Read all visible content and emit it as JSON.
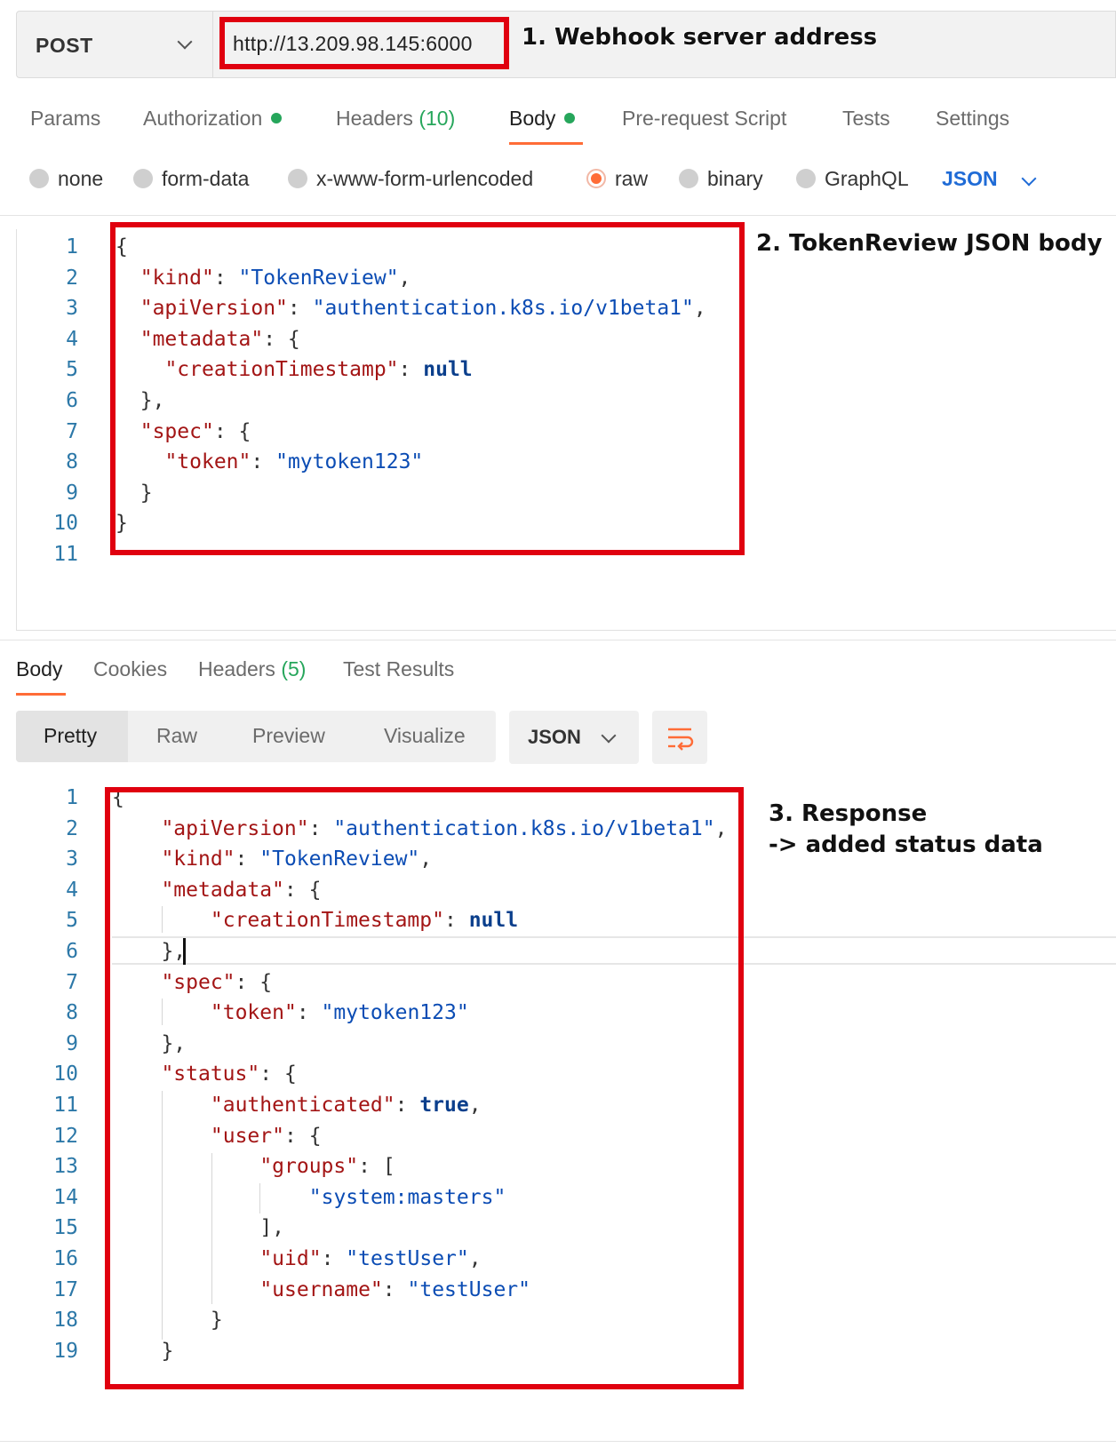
{
  "request": {
    "method": "POST",
    "url": "http://13.209.98.145:6000",
    "tabs": [
      {
        "label": "Params"
      },
      {
        "label": "Authorization"
      },
      {
        "label": "Headers",
        "count": "(10)"
      },
      {
        "label": "Body"
      },
      {
        "label": "Pre-request Script"
      },
      {
        "label": "Tests"
      },
      {
        "label": "Settings"
      }
    ],
    "body_types": [
      "none",
      "form-data",
      "x-www-form-urlencoded",
      "raw",
      "binary",
      "GraphQL"
    ],
    "selected_body_type": "raw",
    "language": "JSON",
    "line_numbers": [
      "1",
      "2",
      "3",
      "4",
      "5",
      "6",
      "7",
      "8",
      "9",
      "10",
      "11"
    ],
    "code_lines": [
      "{",
      "  \"kind\": \"TokenReview\",",
      "  \"apiVersion\": \"authentication.k8s.io/v1beta1\",",
      "  \"metadata\": {",
      "    \"creationTimestamp\": null",
      "  },",
      "  \"spec\": {",
      "    \"token\": \"mytoken123\"",
      "  }",
      "}",
      ""
    ]
  },
  "response": {
    "tabs": [
      {
        "label": "Body"
      },
      {
        "label": "Cookies"
      },
      {
        "label": "Headers",
        "count": "(5)"
      },
      {
        "label": "Test Results"
      }
    ],
    "views": [
      "Pretty",
      "Raw",
      "Preview",
      "Visualize"
    ],
    "format": "JSON",
    "line_numbers": [
      "1",
      "2",
      "3",
      "4",
      "5",
      "6",
      "7",
      "8",
      "9",
      "10",
      "11",
      "12",
      "13",
      "14",
      "15",
      "16",
      "17",
      "18",
      "19"
    ],
    "code_lines": [
      "{",
      "    \"apiVersion\": \"authentication.k8s.io/v1beta1\",",
      "    \"kind\": \"TokenReview\",",
      "    \"metadata\": {",
      "        \"creationTimestamp\": null",
      "    },",
      "    \"spec\": {",
      "        \"token\": \"mytoken123\"",
      "    },",
      "    \"status\": {",
      "        \"authenticated\": true,",
      "        \"user\": {",
      "            \"groups\": [",
      "                \"system:masters\"",
      "            ],",
      "            \"uid\": \"testUser\",",
      "            \"username\": \"testUser\"",
      "        }",
      "    }"
    ]
  },
  "annotations": {
    "a1": "1. Webhook server address",
    "a2": "2. TokenReview JSON body",
    "a3_line1": "3. Response",
    "a3_line2": "-> added status data"
  },
  "colors": {
    "accent": "#ff6c37",
    "annotation_box": "#e0000f",
    "status_dot": "#26a65b",
    "json_key": "#a31515",
    "json_string": "#0b4cb4"
  }
}
